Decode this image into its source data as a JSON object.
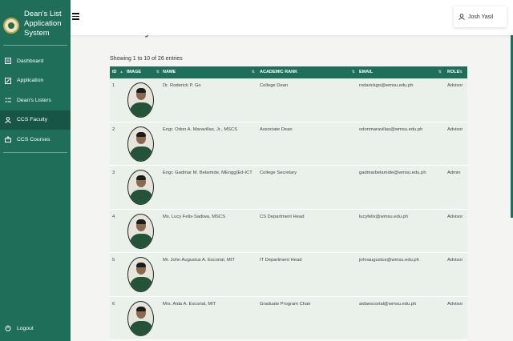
{
  "sidebar": {
    "title_lines": [
      "Dean's List",
      "Application",
      "System"
    ],
    "items": [
      {
        "label": "Dashboard",
        "icon": "dashboard-icon",
        "active": false
      },
      {
        "label": "Application",
        "icon": "edit-icon",
        "active": false
      },
      {
        "label": "Dean's Listers",
        "icon": "list-icon",
        "active": false
      },
      {
        "label": "CCS Faculty",
        "icon": "user-icon",
        "active": true
      },
      {
        "label": "CCS Courses",
        "icon": "course-icon",
        "active": false
      }
    ],
    "logout_label": "Logout"
  },
  "header": {
    "user_name": "Josh Yasil"
  },
  "main": {
    "page_title": "Faculty and Staff",
    "showing_text": "Showing 1 to 10 of 26 entries"
  },
  "table": {
    "columns": [
      "ID",
      "IMAGE",
      "NAME",
      "ACADEMIC RANK",
      "EMAIL",
      "ROLE"
    ],
    "rows": [
      {
        "id": "1",
        "name": "Dr. Roderick P. Go",
        "rank": "College Dean",
        "email": "rodarickgo@wmsu.edu.ph",
        "role": "Advisor"
      },
      {
        "id": "2",
        "name": "Engr. Odon A. Maravillas, Jr., MSCS",
        "rank": "Associate Dean",
        "email": "odonmaravillas@wmsu.edu.ph",
        "role": "Advisor"
      },
      {
        "id": "3",
        "name": "Engr. Gadmar M. Belamide, MEngg(Ed-ICT",
        "rank": "College Secretary",
        "email": "gadmarbelamide@wmsu.edu.ph",
        "role": "Admin"
      },
      {
        "id": "4",
        "name": "Ms. Lucy Felix-Sadiwa, MSCS",
        "rank": "CS Department Head",
        "email": "lucyfelix@wmsu.edu.ph",
        "role": "Advisor"
      },
      {
        "id": "5",
        "name": "Mr. John Augustus A. Escorial, MIT",
        "rank": "IT Department Head",
        "email": "johnaugustus@wmsu.edu.ph",
        "role": "Advisor"
      },
      {
        "id": "6",
        "name": "Mrs. Aida A. Escorial, MIT",
        "rank": "Graduate Program Chair",
        "email": "aidaescorial@wmsu.edu.ph",
        "role": "Advisor"
      }
    ]
  },
  "colors": {
    "sidebar": "#1f6e5a",
    "sidebar_active": "#175646",
    "table_header": "#1f6e5a",
    "row_background": "#e9f1ea"
  }
}
